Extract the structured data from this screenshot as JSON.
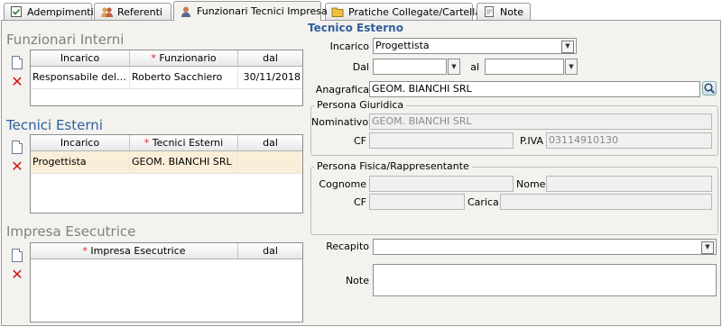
{
  "tabs": [
    {
      "label": "Adempimenti",
      "icon": "checkbox-icon"
    },
    {
      "label": "Referenti",
      "icon": "people-icon"
    },
    {
      "label": "Funzionari Tecnici Impresa",
      "icon": "person-icon"
    },
    {
      "label": "Pratiche Collegate/Cartella",
      "icon": "folder-icon"
    },
    {
      "label": "Note",
      "icon": "note-icon"
    }
  ],
  "funzionari_interni": {
    "title": "Funzionari Interni",
    "columns": [
      "Incarico",
      "Funzionario",
      "dal"
    ],
    "rows": [
      {
        "incarico": "Responsabile del pr…",
        "funzionario": "Roberto Sacchiero",
        "dal": "30/11/2018"
      }
    ]
  },
  "tecnici_esterni": {
    "title": "Tecnici Esterni",
    "columns": [
      "Incarico",
      "Tecnici Esterni",
      "dal"
    ],
    "rows": [
      {
        "incarico": "Progettista",
        "tecnico": "GEOM. BIANCHI SRL",
        "dal": ""
      }
    ]
  },
  "impresa_esecutrice": {
    "title": "Impresa Esecutrice",
    "columns": [
      "Impresa Esecutrice",
      "dal"
    ],
    "rows": []
  },
  "required_mark": "*",
  "tecnico_esterno": {
    "title": "Tecnico Esterno",
    "incarico_label": "Incarico",
    "incarico_value": "Progettista",
    "dal_label": "Dal",
    "dal_value": "",
    "al_label": "al",
    "al_value": "",
    "anagrafica_label": "Anagrafica",
    "anagrafica_value": "GEOM. BIANCHI SRL",
    "persona_giuridica": {
      "title": "Persona Giuridica",
      "nominativo_label": "Nominativo",
      "nominativo_value": "GEOM. BIANCHI SRL",
      "cf_label": "CF",
      "cf_value": "",
      "piva_label": "P.IVA",
      "piva_value": "03114910130"
    },
    "persona_fisica": {
      "title": "Persona Fisica/Rappresentante",
      "cognome_label": "Cognome",
      "cognome_value": "",
      "nome_label": "Nome",
      "nome_value": "",
      "cf_label": "CF",
      "cf_value": "",
      "carica_label": "Carica",
      "carica_value": ""
    },
    "recapito_label": "Recapito",
    "recapito_value": "",
    "note_label": "Note",
    "note_value": ""
  }
}
